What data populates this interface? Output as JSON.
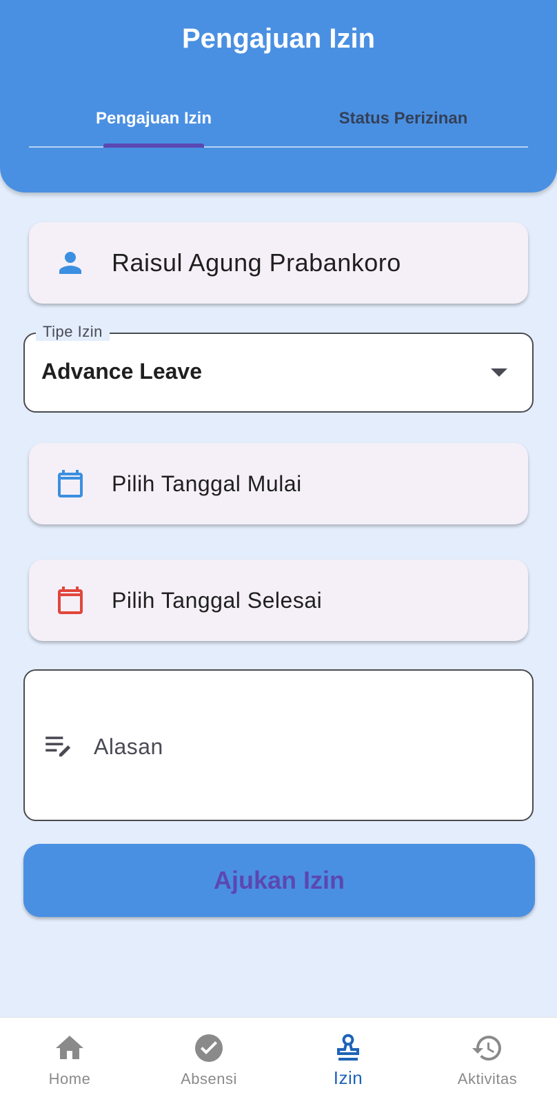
{
  "app_bar": {
    "title": "Pengajuan Izin",
    "tabs": [
      {
        "label": "Pengajuan Izin",
        "active": true
      },
      {
        "label": "Status Perizinan",
        "active": false
      }
    ]
  },
  "form": {
    "employee_name": "Raisul Agung Prabankoro",
    "leave_type": {
      "label": "Tipe Izin",
      "selected": "Advance Leave"
    },
    "start_date": {
      "placeholder": "Pilih Tanggal Mulai",
      "icon": "calendar-icon",
      "icon_color": "#3b8fe0"
    },
    "end_date": {
      "placeholder": "Pilih Tanggal Selesai",
      "icon": "calendar-icon",
      "icon_color": "#e2453c"
    },
    "reason": {
      "placeholder": "Alasan",
      "icon": "edit-note-icon"
    },
    "submit_label": "Ajukan Izin"
  },
  "bottom_nav": {
    "items": [
      {
        "label": "Home",
        "icon": "home-icon",
        "active": false
      },
      {
        "label": "Absensi",
        "icon": "check-circle-icon",
        "active": false
      },
      {
        "label": "Izin",
        "icon": "stamp-icon",
        "active": true
      },
      {
        "label": "Aktivitas",
        "icon": "history-icon",
        "active": false
      }
    ]
  },
  "colors": {
    "primary": "#4a90e2",
    "accent": "#5b48b2",
    "background": "#e3edfb",
    "nav_active": "#1e63b8",
    "nav_inactive": "#8a8a8a"
  }
}
